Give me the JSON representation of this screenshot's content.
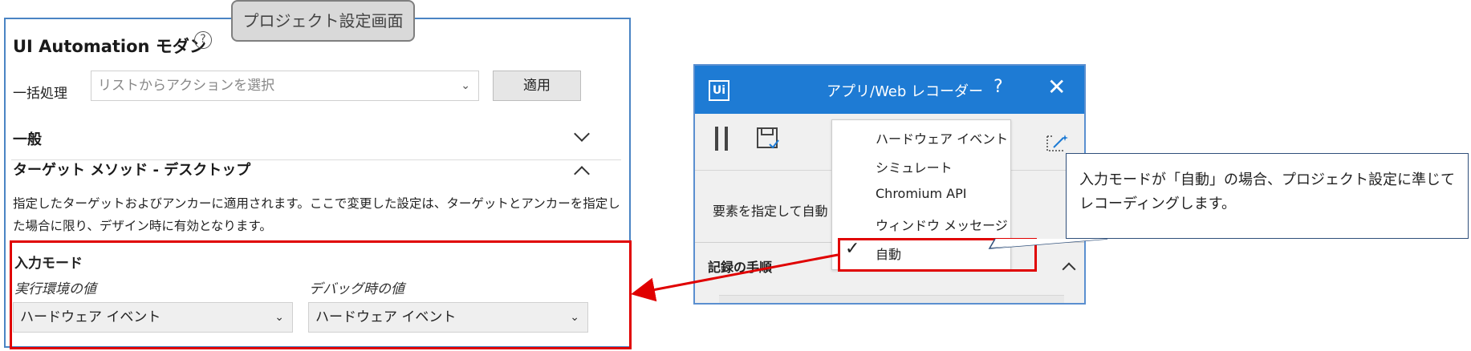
{
  "settings": {
    "tooltip_title": "プロジェクト設定画面",
    "title": "UI Automation モダン",
    "bulk_label": "一括処理",
    "bulk_placeholder": "リストからアクションを選択",
    "apply_label": "適用",
    "general_label": "一般",
    "target_method_label": "ターゲット メソッド - デスクトップ",
    "target_desc": "指定したターゲットおよびアンカーに適用されます。ここで変更した設定は、ターゲットとアンカーを指定した場合に限り、デザイン時に有効となります。",
    "input_mode_label": "入力モード",
    "runtime_label": "実行環境の値",
    "debug_label": "デバッグ時の値",
    "runtime_value": "ハードウェア イベント",
    "debug_value": "ハードウェア イベント"
  },
  "recorder": {
    "logo": "Ui",
    "title": "アプリ/Web レコーダー",
    "help": "?",
    "close": "✕",
    "element_label": "要素を指定して自動",
    "steps_label": "記録の手順",
    "menu_items": [
      "ハードウェア イベント",
      "シミュレート",
      "Chromium API",
      "ウィンドウ メッセージ",
      "自動"
    ],
    "selected_item": "自動"
  },
  "callout": {
    "text": "入力モードが「自動」の場合、プロジェクト設定に準じてレコーディングします。"
  },
  "colors": {
    "highlight": "#e00000",
    "titlebar": "#1e7bd4",
    "panel_border": "#4a84c4"
  }
}
